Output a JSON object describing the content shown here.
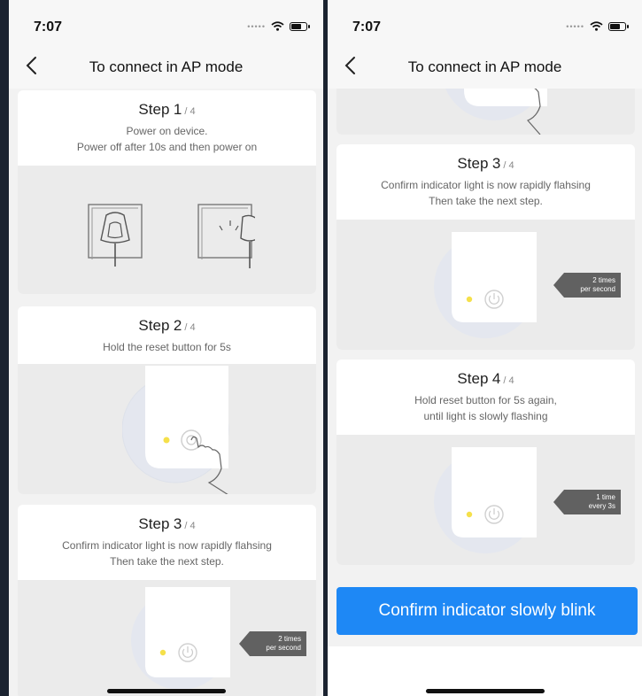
{
  "status_bar": {
    "time": "7:07"
  },
  "nav": {
    "title": "To connect in AP mode"
  },
  "steps": {
    "step1": {
      "title": "Step",
      "num": "1",
      "total": "/ 4",
      "desc1": "Power on device.",
      "desc2": "Power off after 10s and then power on"
    },
    "step2": {
      "title": "Step",
      "num": "2",
      "total": "/ 4",
      "desc1": "Hold the reset button for 5s"
    },
    "step3": {
      "title": "Step",
      "num": "3",
      "total": "/ 4",
      "desc1": "Confirm indicator light is now rapidly flahsing",
      "desc2": "Then take the next step.",
      "badge_line1": "2 times",
      "badge_line2": "per second"
    },
    "step4": {
      "title": "Step",
      "num": "4",
      "total": "/ 4",
      "desc1": "Hold reset button for 5s again,",
      "desc2": "until light is slowly flashing",
      "badge_line1": "1 time",
      "badge_line2": "every 3s"
    }
  },
  "confirm_button": {
    "label": "Confirm indicator slowly blink"
  },
  "colors": {
    "accent": "#1e88f5",
    "indicator": "#f5e04a",
    "badge": "#616161"
  },
  "icons": [
    "back-chevron-icon",
    "signal-dots-icon",
    "wifi-icon",
    "battery-icon",
    "socket-plug-icon",
    "hand-pointer-icon",
    "power-button-icon",
    "indicator-light-icon"
  ]
}
